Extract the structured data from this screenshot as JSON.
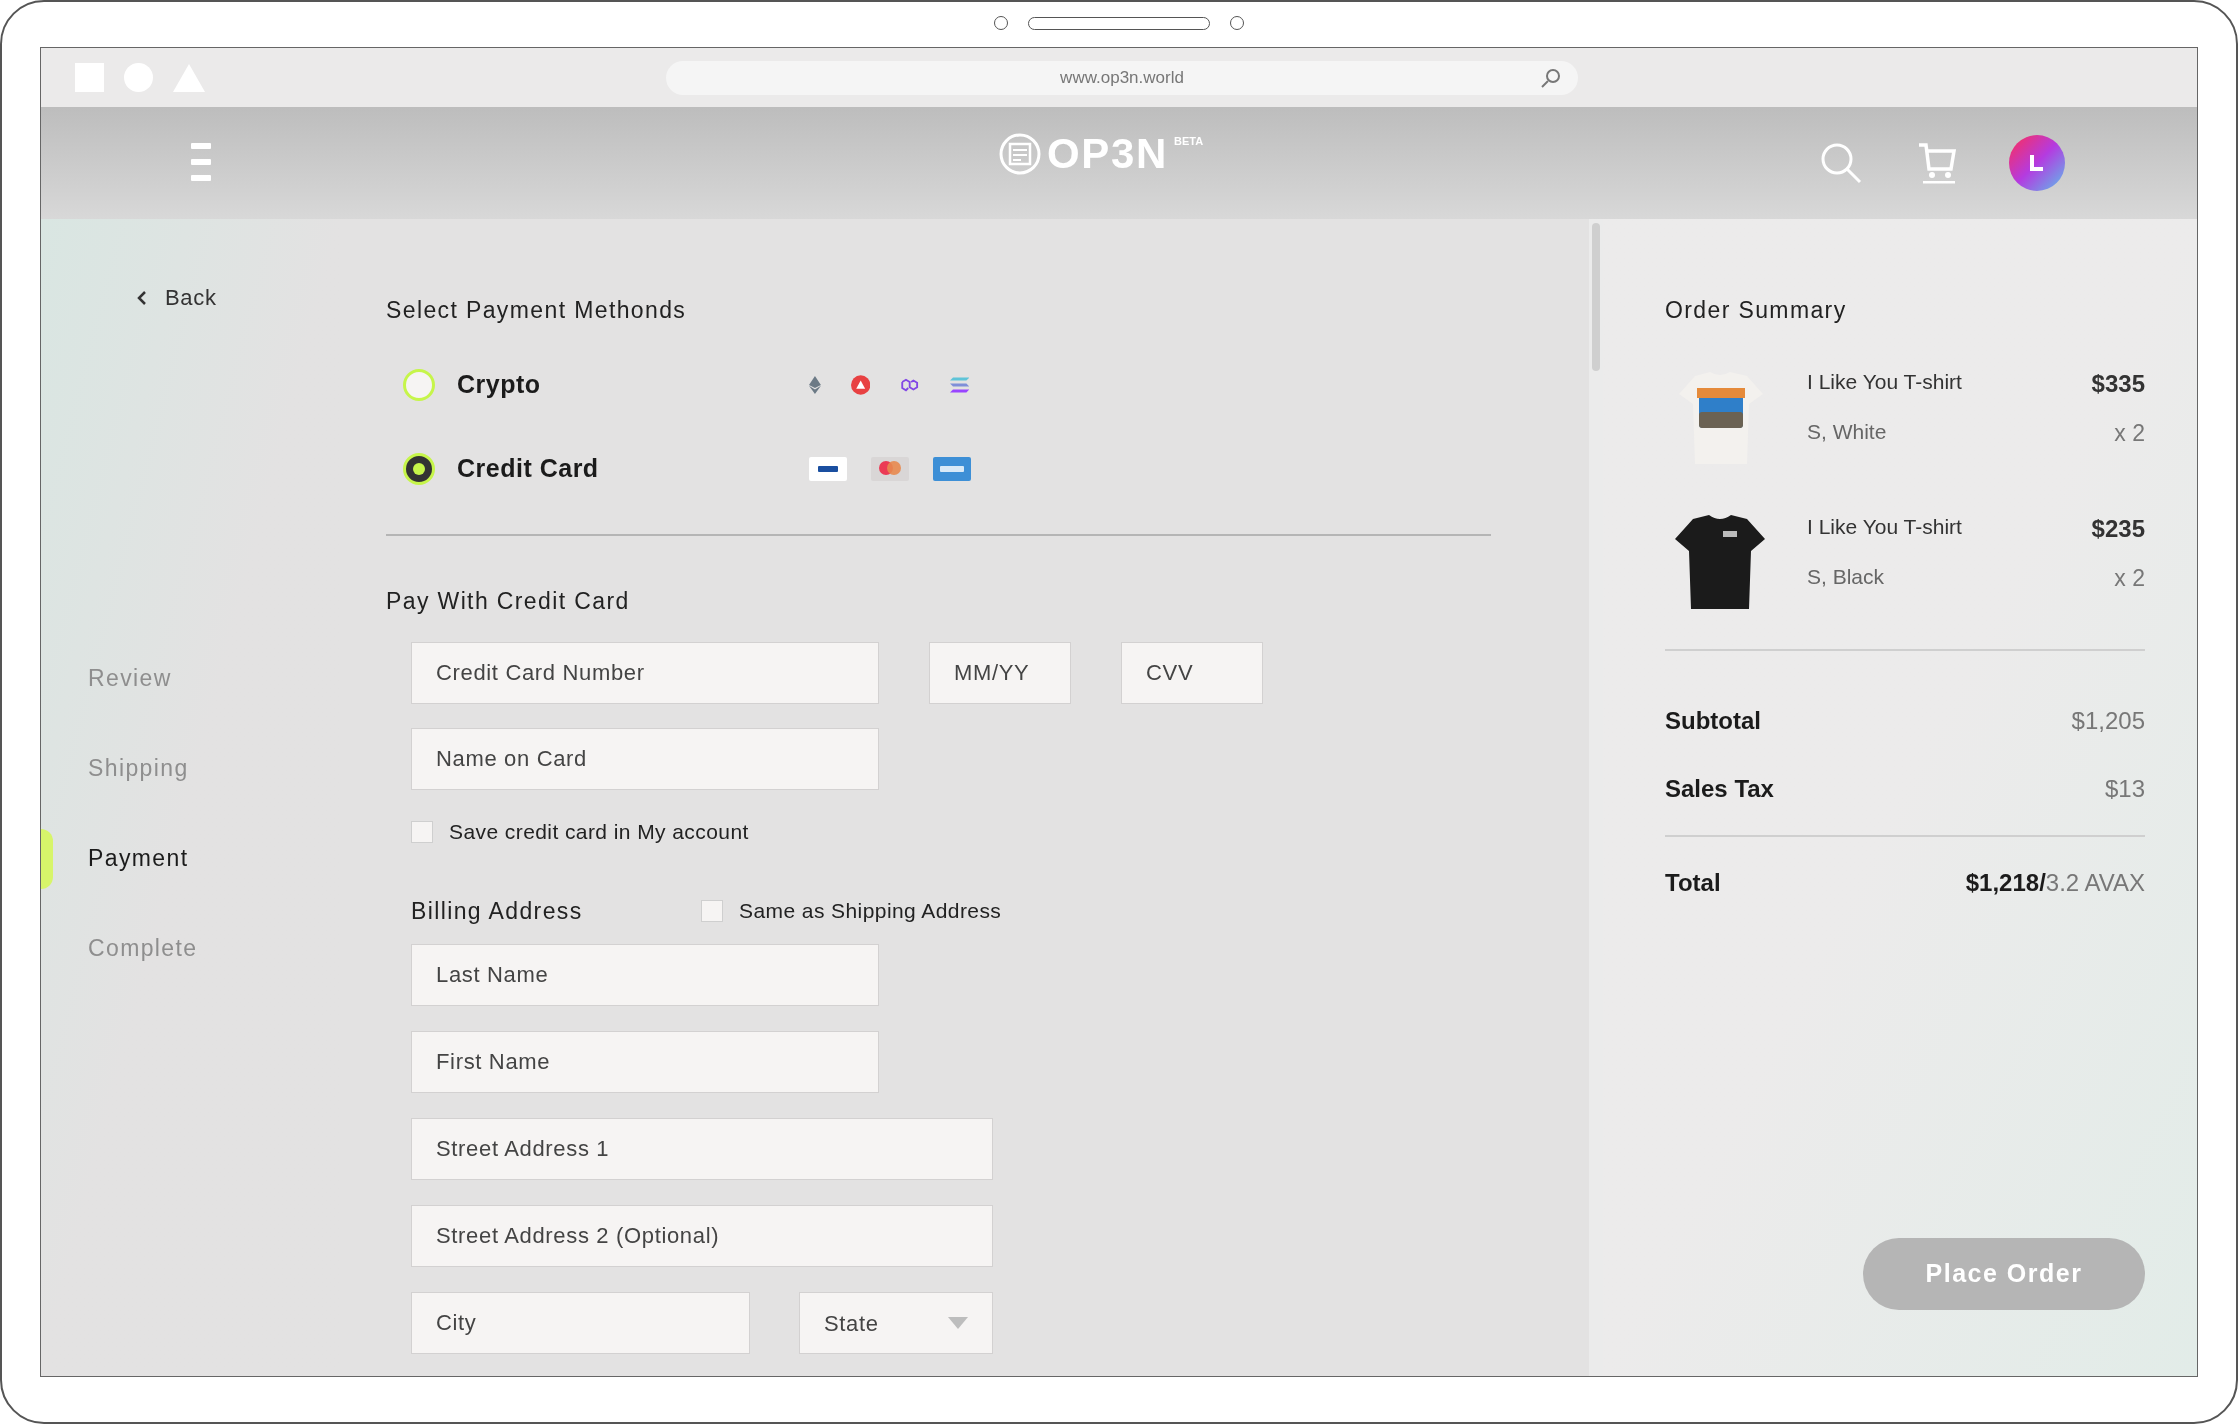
{
  "browser": {
    "url": "www.op3n.world"
  },
  "header": {
    "logo": "OP3N",
    "logo_badge": "BETA"
  },
  "back": {
    "label": "Back"
  },
  "steps": [
    {
      "label": "Review",
      "selected": false
    },
    {
      "label": "Shipping",
      "selected": false
    },
    {
      "label": "Payment",
      "selected": true
    },
    {
      "label": "Complete",
      "selected": false
    }
  ],
  "payment_methods": {
    "title": "Select Payment Methonds",
    "options": [
      {
        "label": "Crypto",
        "selected": false,
        "kind": "crypto"
      },
      {
        "label": "Credit Card",
        "selected": true,
        "kind": "card"
      }
    ]
  },
  "credit_card": {
    "title": "Pay With Credit Card",
    "number": {
      "placeholder": "Credit Card Number"
    },
    "expiry": {
      "placeholder": "MM/YY"
    },
    "cvv": {
      "placeholder": "CVV"
    },
    "name": {
      "placeholder": "Name on Card"
    },
    "save": {
      "label": "Save credit card in My account",
      "checked": false
    }
  },
  "billing": {
    "title": "Billing Address",
    "same_as_shipping": {
      "label": "Same as Shipping Address",
      "checked": false
    },
    "fields": [
      {
        "placeholder": "Last Name",
        "kind": "short"
      },
      {
        "placeholder": "First Name",
        "kind": "short"
      },
      {
        "placeholder": "Street Address 1",
        "kind": "long"
      },
      {
        "placeholder": "Street Address 2 (Optional)",
        "kind": "long"
      }
    ],
    "city": {
      "placeholder": "City"
    },
    "state": {
      "placeholder": "State"
    }
  },
  "order_summary": {
    "title": "Order Summary",
    "items": [
      {
        "name": "I Like You T-shirt",
        "variant": "S, White",
        "price": "$335",
        "quantity": "x 2",
        "kind": "white"
      },
      {
        "name": "I Like You T-shirt",
        "variant": "S, Black",
        "price": "$235",
        "quantity": "x 2",
        "kind": "black"
      }
    ],
    "subtotal": {
      "label": "Subtotal",
      "value": "$1,205"
    },
    "tax": {
      "label": "Sales Tax",
      "value": "$13"
    },
    "total": {
      "label": "Total",
      "value": "$1,218/",
      "alt": "3.2 AVAX"
    },
    "button": "Place Order"
  }
}
